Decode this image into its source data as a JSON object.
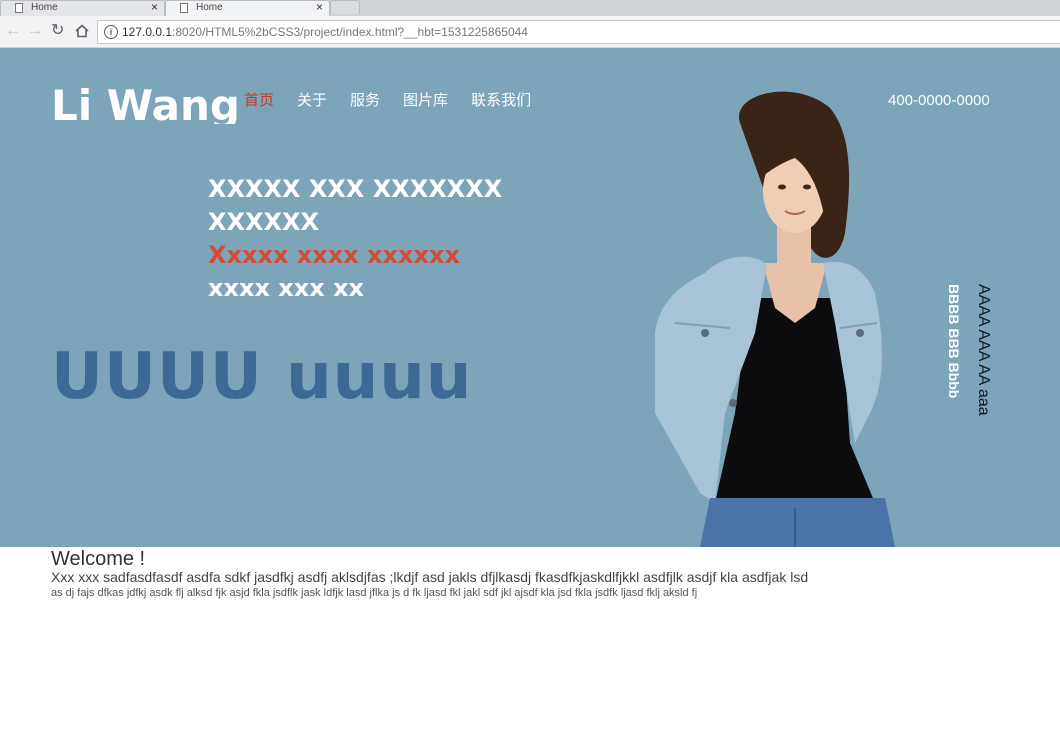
{
  "browser": {
    "tabs": [
      {
        "title": "Home",
        "close": "×"
      },
      {
        "title": "Home",
        "close": "×"
      }
    ],
    "url_host": "127.0.0.1",
    "url_rest": ":8020/HTML5%2bCSS3/project/index.html?__hbt=1531225865044"
  },
  "header": {
    "logo": "Li Wang",
    "menu": [
      "首页",
      "关于",
      "服务",
      "图片库",
      "联系我们"
    ],
    "phone": "400-0000-0000"
  },
  "hero": {
    "line1": "XXXXX XXX XXXXXXX XXXXXX",
    "line2_red": "Xxxxx xxxx xxxxxx",
    "line2_white": "xxxx xxx xx",
    "big": "UUUU uuuu",
    "vertical_a": "BBBB BBB Bbbb",
    "vertical_b": "AAAA AAA AA aaa"
  },
  "content": {
    "welcome": "Welcome !",
    "para1": "Xxx xxx sadfasdfasdf asdfa sdkf jasdfkj asdfj aklsdjfas ;lkdjf asd jakls dfjlkasdj fkasdfkjaskdlfjkkl asdfjlk asdjf kla asdfjak lsd",
    "para2": "as dj fajs dfkas jdfkj asdk flj alksd fjk asjd fkla jsdflk jask ldfjk lasd jflka js d fk ljasd fkl jakl sdf jkl ajsdf kla jsd fkla jsdfk ljasd fklj aksld fj"
  },
  "colors": {
    "hero_bg": "#7da5b9",
    "active_menu": "#c0392b",
    "headline_red": "#d24b33",
    "big_text": "#3b6b95"
  }
}
